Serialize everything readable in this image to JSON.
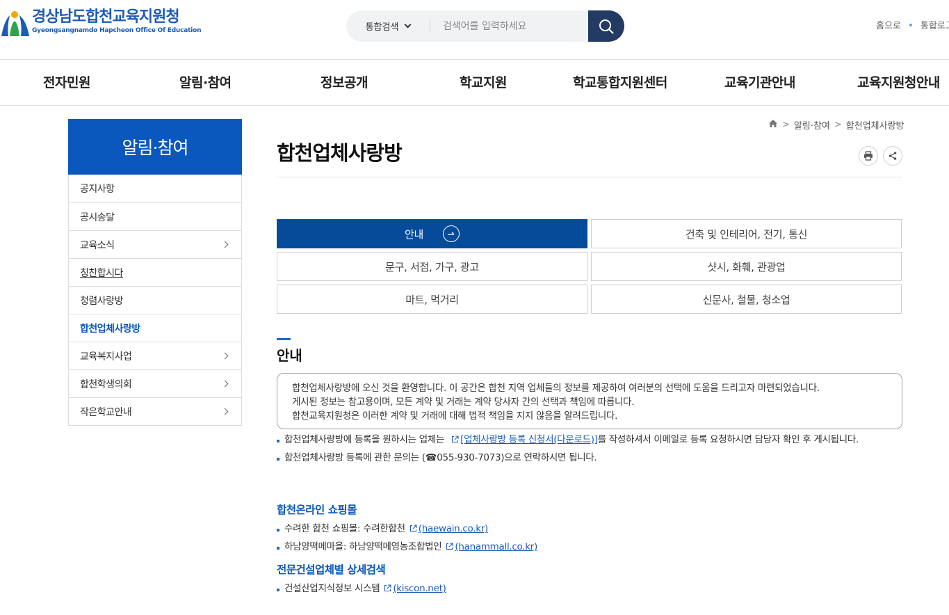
{
  "header": {
    "logo_ko": "경상남도합천교육지원청",
    "logo_en": "Gyeongsangnamdo Hapcheon Office Of Education",
    "search_scope": "통합검색",
    "search_placeholder": "검색어를 입력하세요",
    "util_home": "홈으로",
    "util_login": "통합로그인"
  },
  "gnb": [
    "전자민원",
    "알림·참여",
    "정보공개",
    "학교지원",
    "학교통합지원센터",
    "교육기관안내",
    "교육지원청안내"
  ],
  "lnb": {
    "title": "알림·참여",
    "items": [
      {
        "label": "공지사항"
      },
      {
        "label": "공시송달"
      },
      {
        "label": "교육소식"
      },
      {
        "label": "칭찬합시다"
      },
      {
        "label": "청렴사랑방"
      },
      {
        "label": "합천업체사랑방"
      },
      {
        "label": "교육복지사업"
      },
      {
        "label": "합천학생의회"
      },
      {
        "label": "작은학교안내"
      }
    ]
  },
  "breadcrumb": {
    "level1": "알림·참여",
    "level2": "합천업체사랑방"
  },
  "page_title": "합천업체사랑방",
  "tabs": [
    "안내",
    "건축 및 인테리어, 전기, 통신",
    "문구, 서점, 가구, 광고",
    "샷시, 화훼, 관광업",
    "마트, 먹거리",
    "신문사, 철물, 청소업"
  ],
  "section_title": "안내",
  "notice": {
    "line1": "합천업체사랑방에 오신 것을 환영합니다. 이 공간은 합천 지역 업체들의 정보를 제공하여 여러분의 선택에 도움을 드리고자 마련되었습니다.",
    "line2": "게시된 정보는 참고용이며, 모든 계약 및 거래는 계약 당사자 간의 선택과 책임에 따릅니다.",
    "line3": "합천교육지원청은 이러한 계약 및 거래에 대해 법적 책임을 지지 않음을 알려드립니다."
  },
  "info": {
    "b1_pre": "합천업체사랑방에 등록을 원하시는 업체는",
    "b1_link": "[업체사랑방 등록 신청서(다운로드)]",
    "b1_post": "를 작성하셔서 이메일로 등록 요청하시면 담당자 확인 후 게시됩니다.",
    "b2": "합천업체사랑방 등록에 관한 문의는 (☎055-930-7073)으로 연락하시면 됩니다."
  },
  "shopping": {
    "title": "합천온라인 쇼핑몰",
    "items": [
      {
        "text": "수려한 합천 쇼핑몰: 수려한합천",
        "link": "(haewain.co.kr)"
      },
      {
        "text": "하남양떡메마을: 하남양떡메영농조합법인",
        "link": "(hanammall.co.kr)"
      }
    ]
  },
  "construction": {
    "title": "전문건설업체별 상세검색",
    "items": [
      {
        "text": "건설산업지식정보 시스템",
        "link": "(kiscon.net)"
      }
    ]
  },
  "colors": {
    "brand": "#0a58bd",
    "tab_active": "#064b99",
    "search_btn": "#233a63"
  }
}
